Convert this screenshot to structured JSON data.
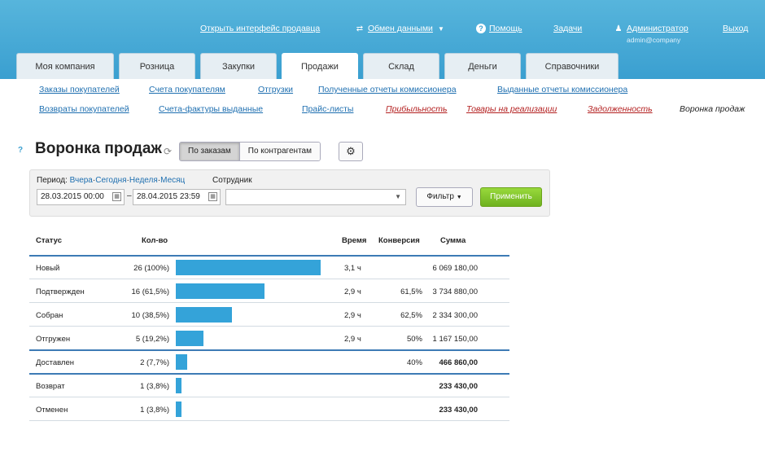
{
  "topbar": {
    "open_seller": "Открыть интерфейс продавца",
    "exchange": "Обмен данными",
    "help": "Помощь",
    "tasks": "Задачи",
    "user": "Администратор",
    "user_email": "admin@company",
    "logout": "Выход"
  },
  "tabs": [
    "Моя компания",
    "Розница",
    "Закупки",
    "Продажи",
    "Склад",
    "Деньги",
    "Справочники"
  ],
  "active_tab": "Продажи",
  "subnav": {
    "row1": [
      "Заказы покупателей",
      "Счета покупателям",
      "Отгрузки",
      "Полученные отчеты комиссионера",
      "Выданные отчеты комиссионера"
    ],
    "row2": [
      "Возвраты покупателей",
      "Счета-фактуры выданные",
      "Прайс-листы",
      "Прибыльность",
      "Товары на реализации",
      "Задолженность",
      "Воронка продаж"
    ]
  },
  "page": {
    "title": "Воронка продаж",
    "seg_orders": "По заказам",
    "seg_counterparties": "По контрагентам"
  },
  "filter": {
    "period_label": "Период:",
    "yesterday": "Вчера",
    "today": "Сегодня",
    "week": "Неделя",
    "month": "Месяц",
    "employee_label": "Сотрудник",
    "date_from": "28.03.2015 00:00",
    "date_to": "28.04.2015 23:59",
    "filter_btn": "Фильтр",
    "apply_btn": "Применить"
  },
  "table": {
    "headers": {
      "status": "Статус",
      "count": "Кол-во",
      "time": "Время",
      "conversion": "Конверсия",
      "sum": "Сумма"
    },
    "rows": [
      {
        "status": "Новый",
        "count": "26 (100%)",
        "share": 1.0,
        "time": "3,1 ч",
        "conversion": "",
        "sum": "6 069 180,00",
        "bold": false
      },
      {
        "status": "Подтвержден",
        "count": "16 (61,5%)",
        "share": 0.615,
        "time": "2,9 ч",
        "conversion": "61,5%",
        "sum": "3 734 880,00",
        "bold": false
      },
      {
        "status": "Собран",
        "count": "10 (38,5%)",
        "share": 0.385,
        "time": "2,9 ч",
        "conversion": "62,5%",
        "sum": "2 334 300,00",
        "bold": false
      },
      {
        "status": "Отгружен",
        "count": "5 (19,2%)",
        "share": 0.192,
        "time": "2,9 ч",
        "conversion": "50%",
        "sum": "1 167 150,00",
        "bold": false
      },
      {
        "status": "Доставлен",
        "count": "2 (7,7%)",
        "share": 0.077,
        "time": "",
        "conversion": "40%",
        "sum": "466 860,00",
        "bold": true
      },
      {
        "status": "Возврат",
        "count": "1 (3,8%)",
        "share": 0.038,
        "time": "",
        "conversion": "",
        "sum": "233 430,00",
        "bold": true
      },
      {
        "status": "Отменен",
        "count": "1 (3,8%)",
        "share": 0.038,
        "time": "",
        "conversion": "",
        "sum": "233 430,00",
        "bold": true
      }
    ]
  },
  "colors": {
    "header": "#3a9fd0",
    "bar": "#34a3d9",
    "apply": "#7cc02a",
    "link": "#1e6fb0",
    "link_red": "#b31f1f"
  }
}
